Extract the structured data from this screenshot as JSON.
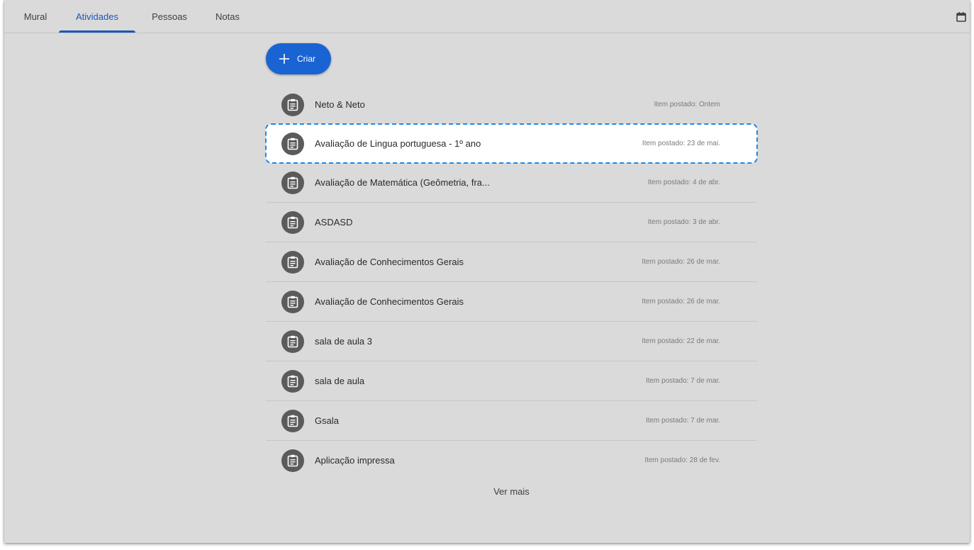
{
  "tabs": [
    {
      "label": "Mural"
    },
    {
      "label": "Atividades"
    },
    {
      "label": "Pessoas"
    },
    {
      "label": "Notas"
    }
  ],
  "active_tab": "Atividades",
  "create_button": {
    "label": "Criar"
  },
  "activities": [
    {
      "title": "Neto & Neto",
      "posted": "Item postado: Ontem"
    },
    {
      "title": "Avaliação de Lingua portuguesa - 1º ano",
      "posted": "Item postado: 23 de mai."
    },
    {
      "title": "Avaliação de Matemática (Geômetria, fra...",
      "posted": "Item postado: 4 de abr."
    },
    {
      "title": "ASDASD",
      "posted": "Item postado: 3 de abr."
    },
    {
      "title": "Avaliação de Conhecimentos Gerais",
      "posted": "Item postado: 26 de mar."
    },
    {
      "title": "Avaliação de Conhecimentos Gerais",
      "posted": "Item postado: 26 de mar."
    },
    {
      "title": "sala de aula 3",
      "posted": "Item postado: 22 de mar."
    },
    {
      "title": "sala de aula",
      "posted": "Item postado: 7 de mar."
    },
    {
      "title": "Gsala",
      "posted": "Item postado: 7 de mar."
    },
    {
      "title": "Aplicação impressa",
      "posted": "Item postado: 28 de fev."
    }
  ],
  "see_more": "Ver mais",
  "icons": {
    "assignment": "assignment-icon",
    "calendar": "calendar-icon",
    "plus": "plus-icon"
  },
  "colors": {
    "accent": "#1a57b8",
    "create_button": "#1a63d2",
    "selection_outline": "#1e88e5",
    "background": "#dadada"
  }
}
